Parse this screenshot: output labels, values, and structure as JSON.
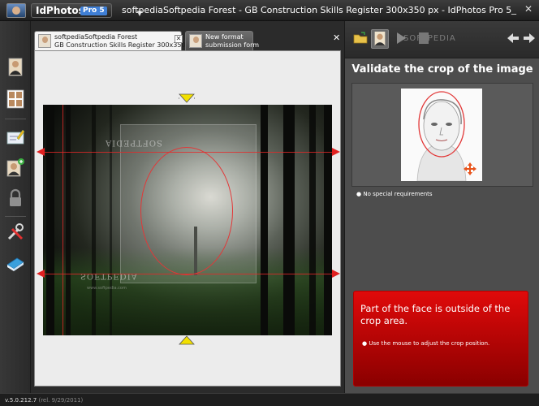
{
  "app": {
    "logo_text": "IdPhotos",
    "logo_badge": "Pro 5",
    "window_title": "softpediaSoftpedia Forest - GB Construction Skills Register 300x350 px - IdPhotos Pro 5",
    "minimize": "_",
    "close": "✕"
  },
  "toolbar": {
    "icons": [
      "person-icon",
      "photo-grid-icon",
      "edit-form-icon",
      "add-person-icon",
      "lock-icon",
      "tools-icon",
      "book-icon"
    ]
  },
  "tabs": [
    {
      "line1": "softpediaSoftpedia Forest",
      "line2": "GB Construction Skills Register 300x350 px"
    },
    {
      "line1": "New format",
      "line2": "submission form"
    }
  ],
  "tab_close": "✕",
  "area_close": "✕",
  "photo": {
    "watermark_top": "SOFTPEDIA",
    "watermark_bottom": "SOFTPEDIA",
    "watermark_sub": "www.softpedia.com"
  },
  "right_panel": {
    "title": "Validate the crop of the image",
    "requirement": "No special requirements",
    "alert_message": "Part of the face is outside of the crop area.",
    "alert_hint": "Use the mouse to adjust the crop position.",
    "watermark": "SOFTPEDIA"
  },
  "status": {
    "version": "v.5.0.212.7",
    "release": "(rel. 9/29/2011)"
  },
  "colors": {
    "accent_red": "#e00a0a",
    "crop_line": "#e23838",
    "handle_yellow": "#f2e000"
  }
}
